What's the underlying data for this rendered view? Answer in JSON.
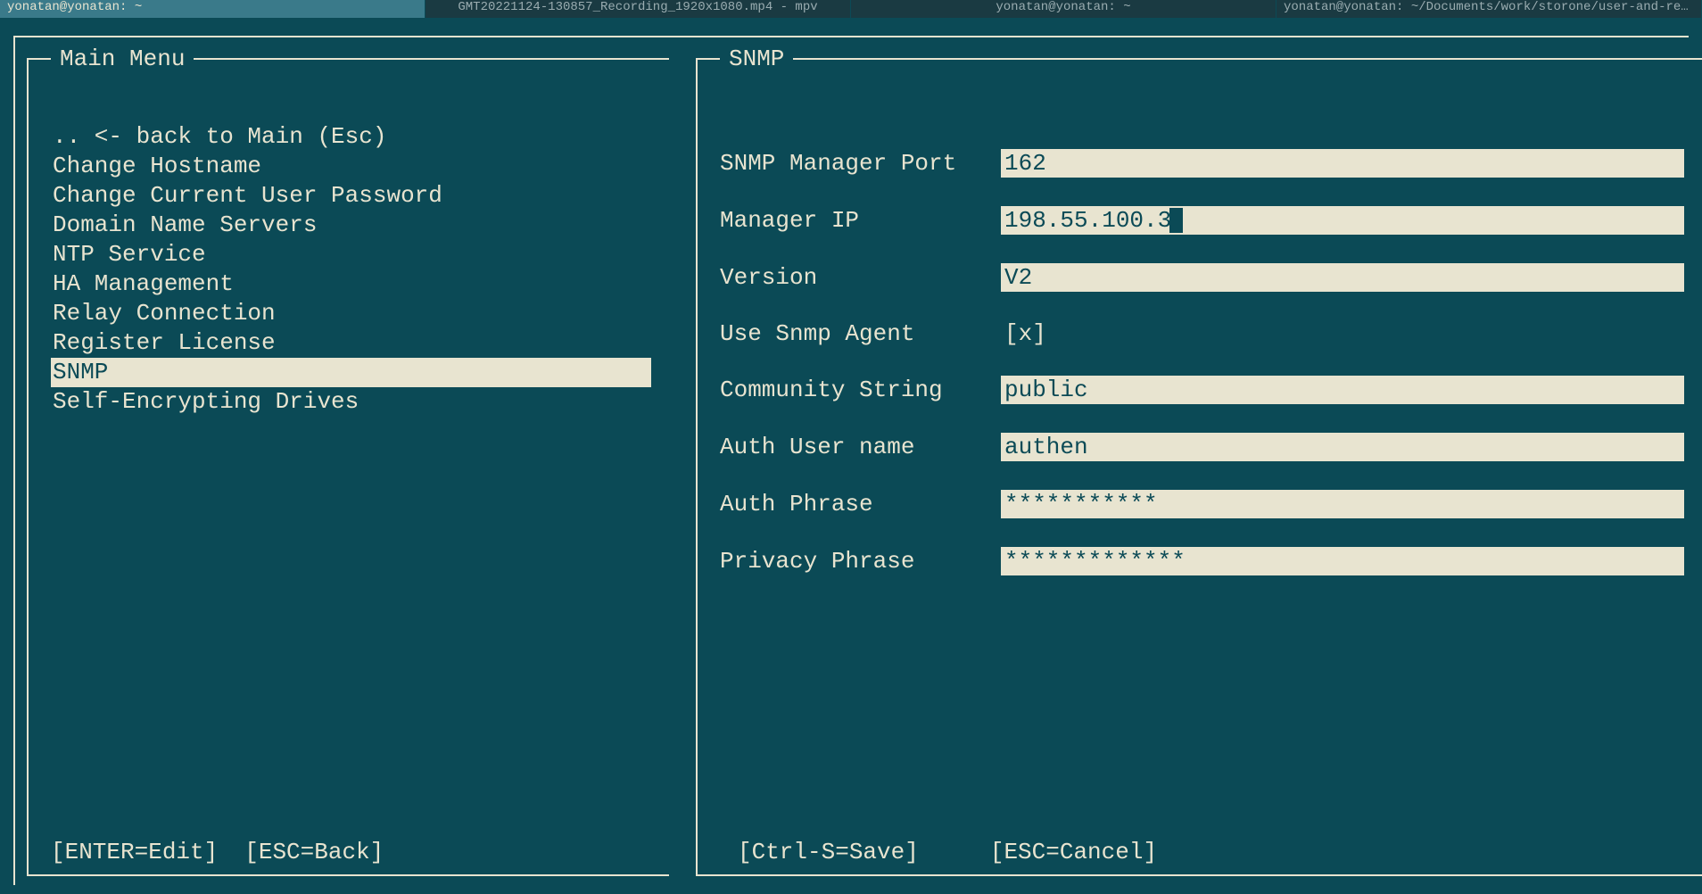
{
  "taskbar": {
    "items": [
      {
        "label": "yonatan@yonatan: ~",
        "active": true
      },
      {
        "label": "GMT20221124-130857_Recording_1920x1080.mp4 - mpv",
        "active": false
      },
      {
        "label": "yonatan@yonatan: ~",
        "active": false
      },
      {
        "label": "yonatan@yonatan: ~/Documents/work/storone/user-and-reference-gui..",
        "active": false
      }
    ]
  },
  "leftPanel": {
    "title": "Main Menu",
    "items": [
      {
        "label": " .. <- back to Main (Esc)",
        "selected": false
      },
      {
        "label": "Change Hostname",
        "selected": false
      },
      {
        "label": "Change Current User Password",
        "selected": false
      },
      {
        "label": "Domain Name Servers",
        "selected": false
      },
      {
        "label": "NTP Service",
        "selected": false
      },
      {
        "label": "HA Management",
        "selected": false
      },
      {
        "label": "Relay Connection",
        "selected": false
      },
      {
        "label": "Register License",
        "selected": false
      },
      {
        "label": "SNMP",
        "selected": true
      },
      {
        "label": "Self-Encrypting Drives",
        "selected": false
      }
    ],
    "footer": {
      "enter": "[ENTER=Edit]",
      "esc": "[ESC=Back]"
    }
  },
  "rightPanel": {
    "title": "SNMP",
    "fields": {
      "managerPort": {
        "label": "SNMP Manager Port",
        "value": "162"
      },
      "managerIp": {
        "label": "Manager IP",
        "value": "198.55.100.3"
      },
      "version": {
        "label": "Version",
        "value": "V2"
      },
      "useAgent": {
        "label": "Use Snmp Agent",
        "value": "[x]"
      },
      "community": {
        "label": "Community String",
        "value": "public"
      },
      "authUser": {
        "label": "Auth User name",
        "value": "authen"
      },
      "authPhrase": {
        "label": "Auth Phrase",
        "value": "***********"
      },
      "privacyPhrase": {
        "label": "Privacy Phrase",
        "value": "*************"
      }
    },
    "footer": {
      "save": "[Ctrl-S=Save]",
      "cancel": "[ESC=Cancel]"
    }
  }
}
